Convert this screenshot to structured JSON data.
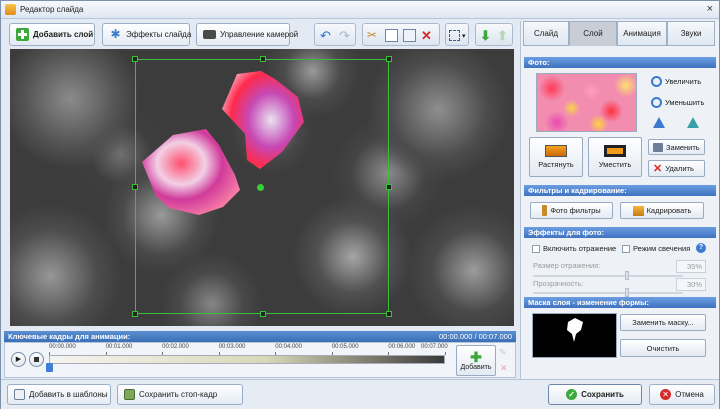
{
  "window": {
    "title": "Редактор слайда"
  },
  "toolbar": {
    "add_layer": "Добавить слой",
    "slide_effects": "Эффекты слайда",
    "camera": "Управление камерой"
  },
  "tabs": [
    "Слайд",
    "Слой",
    "Анимация",
    "Звуки"
  ],
  "active_tab": "Слой",
  "photo": {
    "header": "Фото:",
    "zoom_in": "Увеличить",
    "zoom_out": "Уменьшить",
    "stretch": "Растянуть",
    "fit": "Уместить",
    "replace": "Заменить",
    "delete": "Удалить"
  },
  "filters": {
    "header": "Фильтры и кадрирование:",
    "photo_filters": "Фото фильтры",
    "crop": "Кадрировать"
  },
  "effects": {
    "header": "Эффекты для фото:",
    "reflection": "Включить отражение",
    "glow": "Режим свечения",
    "reflection_size_label": "Размер отражения:",
    "reflection_size_value": "35%",
    "transparency_label": "Прозрачность:",
    "transparency_value": "30%"
  },
  "mask": {
    "header": "Маска слоя - изменение формы:",
    "replace": "Заменить маску...",
    "clear": "Очистить"
  },
  "timeline": {
    "header": "Ключевые кадры для анимации:",
    "time": "00:00.000 / 00:07.000",
    "ticks": [
      "00:00.000",
      "00:01.000",
      "00:02.000",
      "00:03.000",
      "00:04.000",
      "00:05.000",
      "00:06.000",
      "00:07.000"
    ],
    "add": "Добавить"
  },
  "bottom": {
    "add_template": "Добавить в шаблоны",
    "save_frame": "Сохранить стоп-кадр",
    "save": "Сохранить",
    "cancel": "Отмена"
  },
  "colors": {
    "accent": "#3f73c0",
    "selection": "#38c038",
    "save": "#3aa83a",
    "cancel": "#d42a2a"
  }
}
